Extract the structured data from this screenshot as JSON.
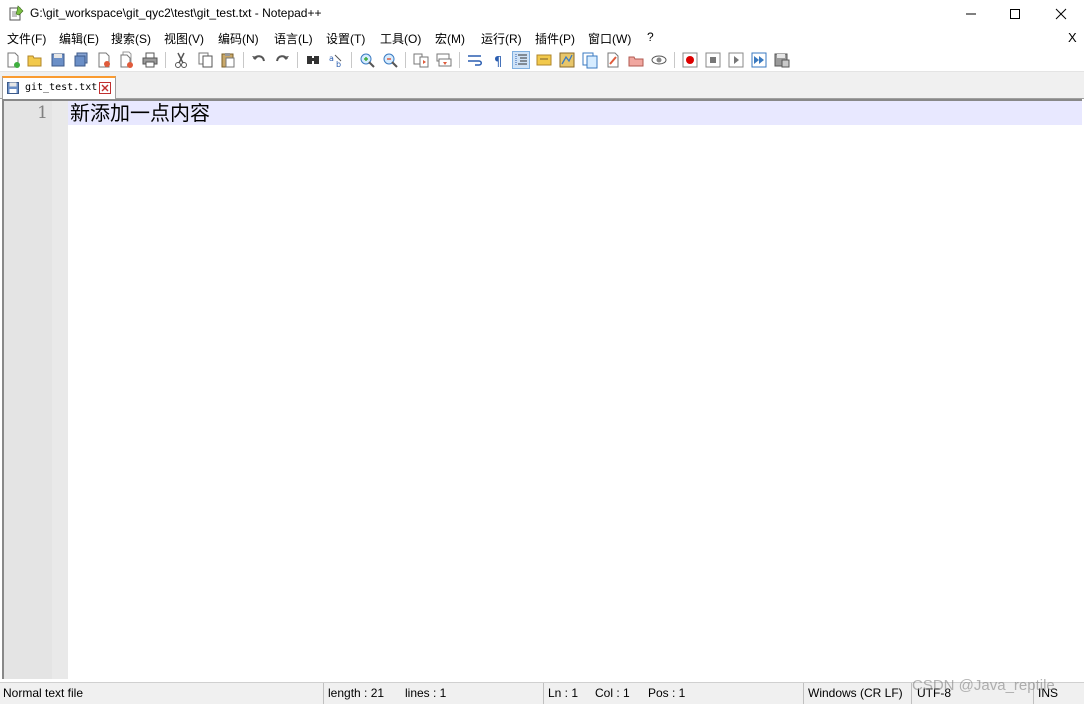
{
  "window": {
    "title": "G:\\git_workspace\\git_qyc2\\test\\git_test.txt - Notepad++"
  },
  "menu": {
    "items": [
      "文件(F)",
      "编辑(E)",
      "搜索(S)",
      "视图(V)",
      "编码(N)",
      "语言(L)",
      "设置(T)",
      "工具(O)",
      "宏(M)",
      "运行(R)",
      "插件(P)",
      "窗口(W)",
      "?"
    ],
    "close_label": "X"
  },
  "toolbar": {
    "icons": [
      "new-file-icon",
      "open-file-icon",
      "save-icon",
      "save-all-icon",
      "close-icon",
      "close-all-icon",
      "print-icon",
      "cut-icon",
      "copy-icon",
      "paste-icon",
      "undo-icon",
      "redo-icon",
      "find-icon",
      "replace-icon",
      "zoom-in-icon",
      "zoom-out-icon",
      "sync-vertical-icon",
      "sync-horizontal-icon",
      "word-wrap-icon",
      "show-all-chars-icon",
      "indent-guide-icon",
      "udl-icon",
      "doc-map-icon",
      "function-list-icon",
      "folder-workspace-icon",
      "monitoring-icon",
      "macro-record-icon",
      "macro-stop-icon",
      "macro-play-icon",
      "macro-run-multiple-icon",
      "macro-save-icon"
    ]
  },
  "tabs": [
    {
      "label": "git_test.txt"
    }
  ],
  "editor": {
    "line_numbers": [
      "1"
    ],
    "lines": [
      "新添加一点内容"
    ]
  },
  "status": {
    "file_type": "Normal text file",
    "length": "length : 21",
    "lines": "lines : 1",
    "ln": "Ln : 1",
    "col": "Col : 1",
    "pos": "Pos : 1",
    "eol": "Windows (CR LF)",
    "encoding": "UTF-8",
    "mode": "INS"
  },
  "watermark": "CSDN @Java_reptile",
  "colors": {
    "tab_accent": "#fa9b30",
    "current_line": "#e8e8ff",
    "gutter": "#e4e4e4"
  }
}
